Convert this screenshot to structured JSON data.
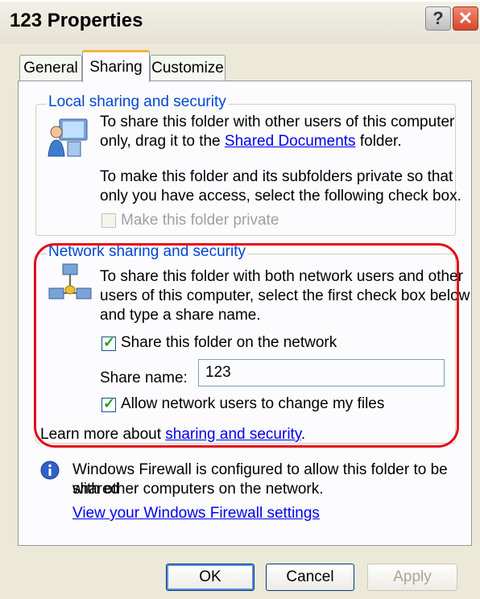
{
  "window": {
    "title": "123 Properties",
    "help_glyph": "?",
    "close_glyph": "✕"
  },
  "tabs": [
    {
      "label": "General",
      "active": false
    },
    {
      "label": "Sharing",
      "active": true
    },
    {
      "label": "Customize",
      "active": false
    }
  ],
  "local": {
    "group_title": "Local sharing and security",
    "desc_before_link": "To share this folder with other users of this computer",
    "desc_line2_prefix": "only, drag it to the",
    "link": "Shared Documents",
    "desc_line2_suffix": "folder.",
    "private_line1": "To make this folder and its subfolders private so that",
    "private_line2": "only you have access, select the following check box.",
    "private_checkbox_label": "Make this folder private",
    "private_checked": false,
    "icon": "computer-users-icon"
  },
  "network": {
    "group_title": "Network sharing and security",
    "desc_line1": "To share this folder with both network users and other",
    "desc_line2": "users of this computer, select the first check box below",
    "desc_line3": "and type a share name.",
    "share_checkbox_label": "Share this folder on the network",
    "share_checked": true,
    "share_name_label": "Share name:",
    "share_name_value": "123",
    "allow_checkbox_label": "Allow network users to change my files",
    "allow_checked": true,
    "learn_prefix": "Learn more about",
    "learn_link": "sharing and security",
    "learn_suffix": ".",
    "icon": "network-icon",
    "highlight_color": "#e30a18"
  },
  "firewall": {
    "line1": "Windows Firewall is configured to allow this folder to be shared",
    "line2": "with other computers on the network.",
    "link": "View your Windows Firewall settings",
    "icon": "info-icon"
  },
  "buttons": {
    "ok": "OK",
    "cancel": "Cancel",
    "apply": "Apply"
  }
}
